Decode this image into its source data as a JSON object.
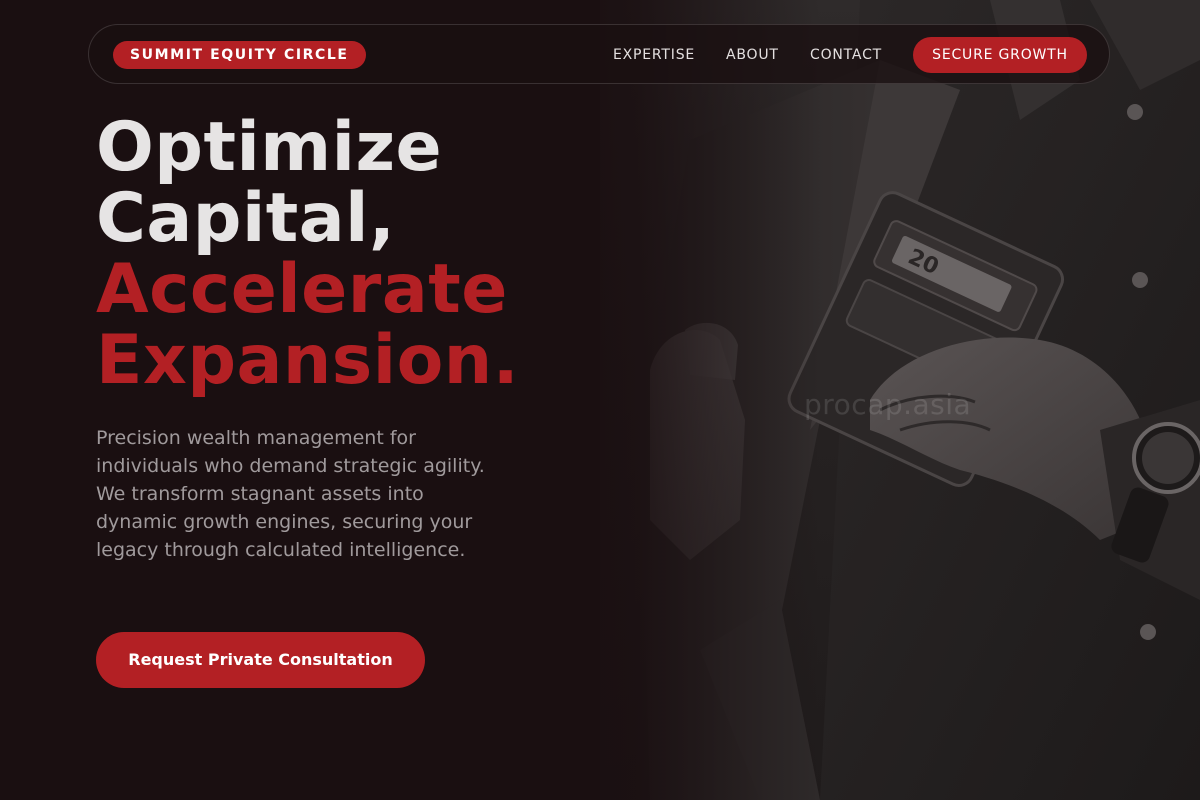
{
  "nav": {
    "brand": "SUMMIT EQUITY CIRCLE",
    "links": [
      {
        "label": "EXPERTISE"
      },
      {
        "label": "ABOUT"
      },
      {
        "label": "CONTACT"
      }
    ],
    "cta_label": "SECURE GROWTH"
  },
  "hero": {
    "headline_line1": "Optimize",
    "headline_line2": "Capital,",
    "headline_line3": "Accelerate",
    "headline_line4": "Expansion.",
    "description": "Precision wealth management for individuals who demand strategic agility. We transform stagnant assets into dynamic growth engines, securing your legacy through calculated intelligence.",
    "cta_label": "Request Private Consultation",
    "image_watermark": "procap.asia",
    "wallet_text": "20"
  },
  "colors": {
    "background": "#1a0f11",
    "accent": "#b32024",
    "headline_light": "#e6e4e4",
    "body_text": "#a09a9c"
  },
  "icons": {
    "hero_image": "man-holding-wallet-photo"
  }
}
